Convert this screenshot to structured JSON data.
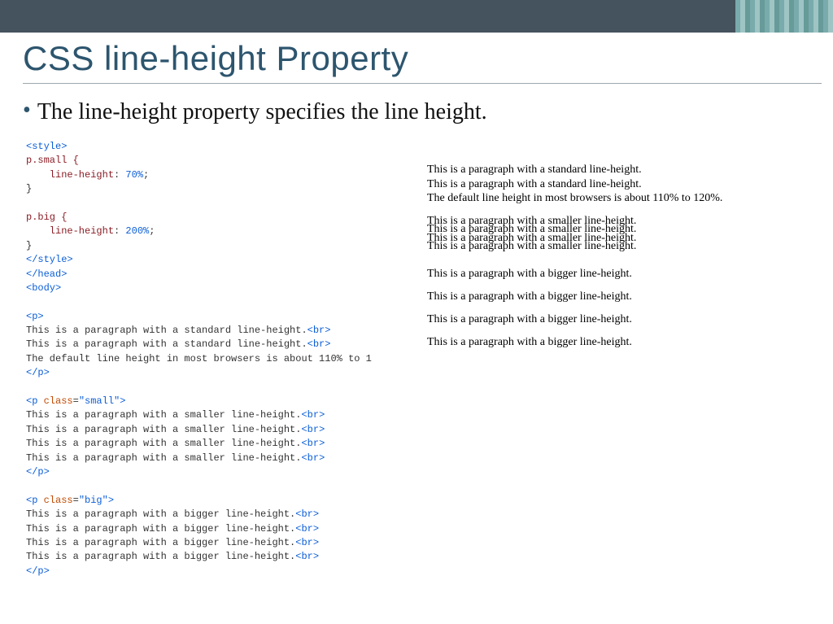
{
  "title": "CSS line-height Property",
  "bullet": "The line-height property specifies the line height.",
  "code": {
    "style_open": "<style>",
    "sel_small": "p.small {",
    "rule_small_prop": "    line-height",
    "rule_small_val": " 70%",
    "close1": "}",
    "sel_big": "p.big {",
    "rule_big_prop": "    line-height",
    "rule_big_val": " 200%",
    "close2": "}",
    "style_close": "</style>",
    "head_close": "</head>",
    "body_open": "<body>",
    "p_open": "<p>",
    "p_small_open_a": "<p ",
    "p_small_open_b": "class",
    "p_small_open_c": "=",
    "p_small_open_d": "\"small\"",
    "p_small_open_e": ">",
    "p_big_open_d": "\"big\"",
    "p_close": "</p>",
    "br": "<br>",
    "t_std1": "This is a paragraph with a standard line-height.",
    "t_std2": "This is a paragraph with a standard line-height.",
    "t_std3": "The default line height in most browsers is about 110% to 1",
    "t_sm": "This is a paragraph with a smaller line-height.",
    "t_bg": "This is a paragraph with a bigger line-height."
  },
  "render": {
    "std1": "This is a paragraph with a standard line-height.",
    "std2": "This is a paragraph with a standard line-height.",
    "std3": "The default line height in most browsers is about 110% to 120%.",
    "sm": "This is a paragraph with a smaller line-height.",
    "bg": "This is a paragraph with a bigger line-height."
  }
}
